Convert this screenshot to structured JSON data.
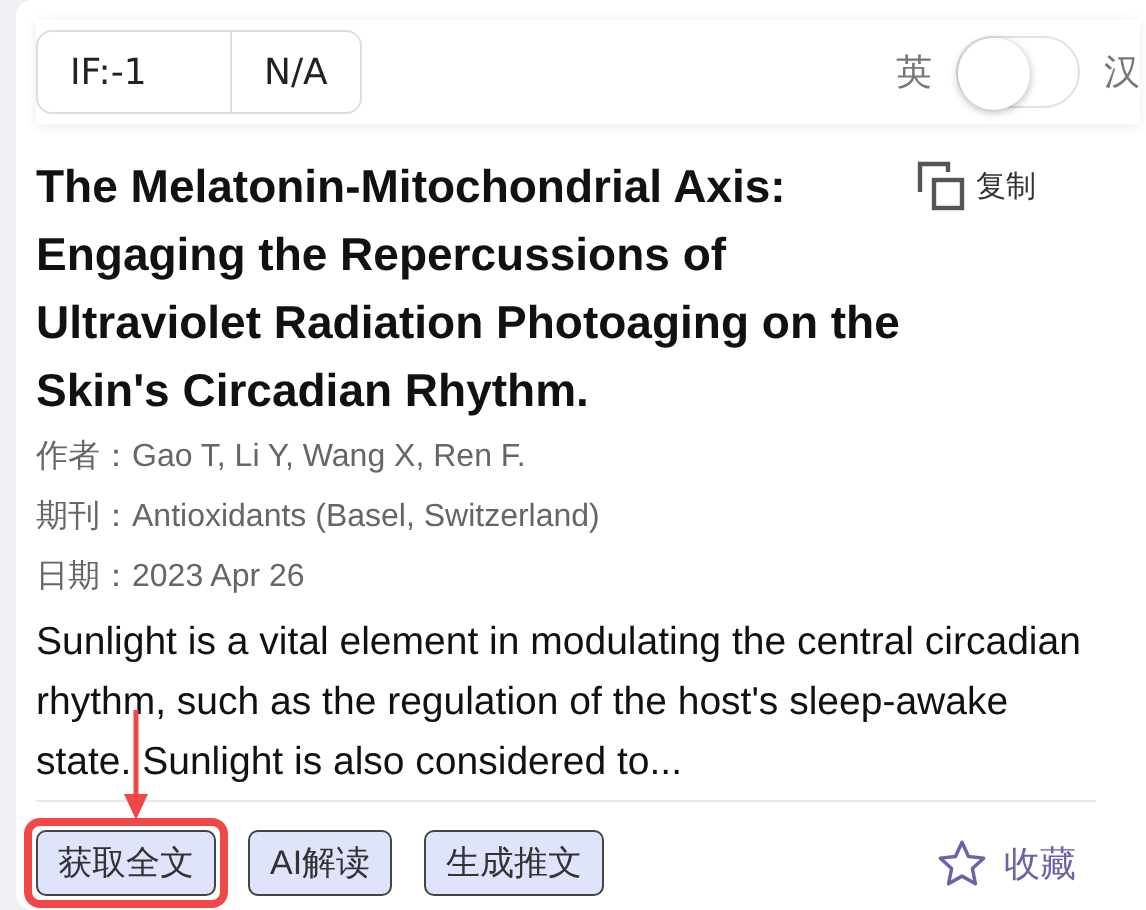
{
  "metrics": [
    {
      "label": "IF:-1"
    },
    {
      "label": "N/A"
    }
  ],
  "language_toggle": {
    "left_label": "英",
    "right_label": "汉",
    "on": false
  },
  "title": "The Melatonin-Mitochondrial Axis: Engaging the Repercussions of Ultraviolet Radiation Photoaging on the Skin's Circadian Rhythm.",
  "copy_button": {
    "label": "复制"
  },
  "meta": [
    {
      "label": "作者：",
      "value": "Gao T, Li Y, Wang X, Ren F."
    },
    {
      "label": "期刊：",
      "value": "Antioxidants (Basel, Switzerland)"
    },
    {
      "label": "日期：",
      "value": "2023 Apr 26"
    }
  ],
  "abstract": "Sunlight is a vital element in modulating the central circadian rhythm, such as the regulation of the host's sleep-awake state. Sunlight is also considered to...",
  "actions": [
    {
      "label": "获取全文",
      "highlighted": true
    },
    {
      "label": "AI解读",
      "highlighted": false
    },
    {
      "label": "生成推文",
      "highlighted": false
    }
  ],
  "favorite": {
    "label": "收藏",
    "selected": false
  }
}
